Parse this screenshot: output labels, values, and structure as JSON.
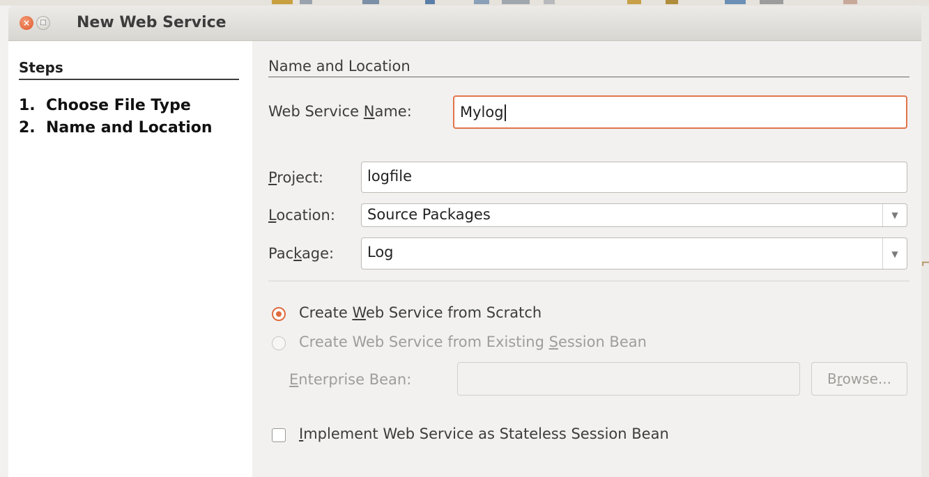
{
  "window": {
    "title": "New Web Service",
    "accent_color": "#df6b3e"
  },
  "steps": {
    "heading": "Steps",
    "items": [
      {
        "number": "1.",
        "label": "Choose File Type"
      },
      {
        "number": "2.",
        "label": "Name and Location"
      }
    ]
  },
  "section": {
    "title": "Name and Location"
  },
  "fields": {
    "web_service_name": {
      "label_pre": "Web Service ",
      "label_mnemonic": "N",
      "label_post": "ame:",
      "value": "Mylog"
    },
    "project": {
      "label_pre": "",
      "label_mnemonic": "P",
      "label_post": "roject:",
      "value": "logfile"
    },
    "location": {
      "label_pre": "",
      "label_mnemonic": "L",
      "label_post": "ocation:",
      "value": "Source Packages"
    },
    "package": {
      "label_pre": "Pac",
      "label_mnemonic": "k",
      "label_post": "age:",
      "value": "Log"
    }
  },
  "options": {
    "from_scratch": {
      "pre": "Create ",
      "mnemonic": "W",
      "post": "eb Service from Scratch",
      "selected": true
    },
    "from_session_bean": {
      "pre": "Create Web Service from Existing ",
      "mnemonic": "S",
      "post": "ession Bean",
      "selected": false
    },
    "enterprise_bean": {
      "pre": "",
      "mnemonic": "E",
      "post": "nterprise Bean:",
      "value": ""
    },
    "browse_button": {
      "pre": "B",
      "mnemonic": "r",
      "post": "owse..."
    },
    "stateless": {
      "pre": "",
      "mnemonic": "I",
      "post": "mplement Web Service as Stateless Session Bean",
      "checked": false
    }
  }
}
